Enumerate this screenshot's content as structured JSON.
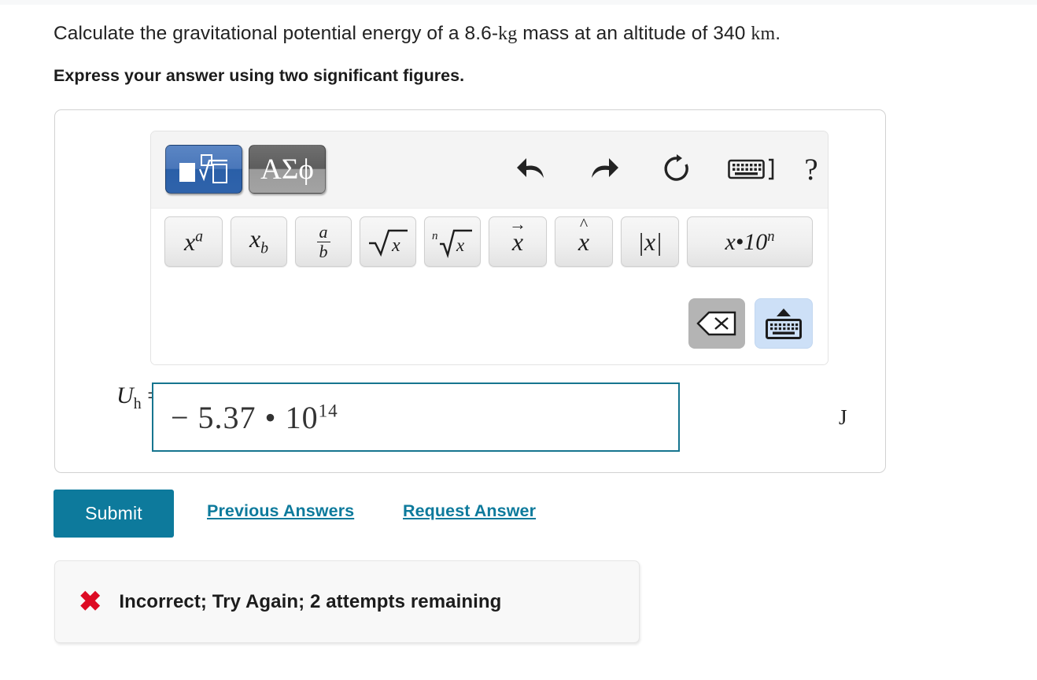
{
  "question": {
    "text_before_mass": "Calculate the gravitational potential energy of a 8.6-",
    "mass_unit": "kg",
    "text_middle": " mass at an altitude of 340 ",
    "altitude_unit": "km",
    "text_end": ".",
    "instruction": "Express your answer using two significant figures."
  },
  "palette": {
    "modes": [
      {
        "name": "math-template-mode",
        "label": "■√□",
        "active": true
      },
      {
        "name": "greek-symbols-mode",
        "label": "ΑΣϕ",
        "active": false
      }
    ],
    "tools": [
      {
        "name": "undo-icon",
        "label": "undo"
      },
      {
        "name": "redo-icon",
        "label": "redo"
      },
      {
        "name": "reset-icon",
        "label": "reset"
      },
      {
        "name": "keyboard-shortcuts-icon",
        "label": "keyboard shortcuts"
      },
      {
        "name": "help-icon",
        "label": "?"
      }
    ],
    "keys": [
      {
        "name": "power-key",
        "label": "x^a"
      },
      {
        "name": "subscript-key",
        "label": "x_b"
      },
      {
        "name": "fraction-key",
        "label": "a/b"
      },
      {
        "name": "square-root-key",
        "label": "√x"
      },
      {
        "name": "nth-root-key",
        "label": "n√x"
      },
      {
        "name": "vector-key",
        "label": "vector x"
      },
      {
        "name": "unit-vector-key",
        "label": "x hat"
      },
      {
        "name": "absolute-value-key",
        "label": "|x|"
      },
      {
        "name": "scientific-notation-key",
        "label": "x•10^n"
      }
    ],
    "key_glyphs": {
      "power_base": "x",
      "power_exp": "a",
      "sub_base": "x",
      "sub_index": "b",
      "frac_num": "a",
      "frac_den": "b",
      "sqrt_arg": "x",
      "nth_index": "n",
      "nth_arg": "x",
      "vector_arg": "x",
      "hat_arg": "x",
      "abs_label": "|x|",
      "sci_label": "x•10",
      "sci_exp": "n"
    },
    "backspace": {
      "name": "backspace-key",
      "label": "backspace"
    },
    "keyboard_toggle": {
      "name": "onscreen-keyboard-toggle",
      "label": "keyboard"
    }
  },
  "answer": {
    "label_symbol": "U",
    "label_subscript": "h",
    "label_equals": "=",
    "value_mantissa": "− 5.37 • 10",
    "value_exponent": "14",
    "unit": "J"
  },
  "actions": {
    "submit": "Submit",
    "previous_answers": "Previous Answers",
    "request_answer": "Request Answer"
  },
  "feedback": {
    "icon": "✖",
    "message": "Incorrect; Try Again; 2 attempts remaining"
  },
  "colors": {
    "accent": "#0d7a9c",
    "input_border": "#16758f",
    "error": "#dd0b24",
    "active_mode": "#2a5fa8"
  }
}
